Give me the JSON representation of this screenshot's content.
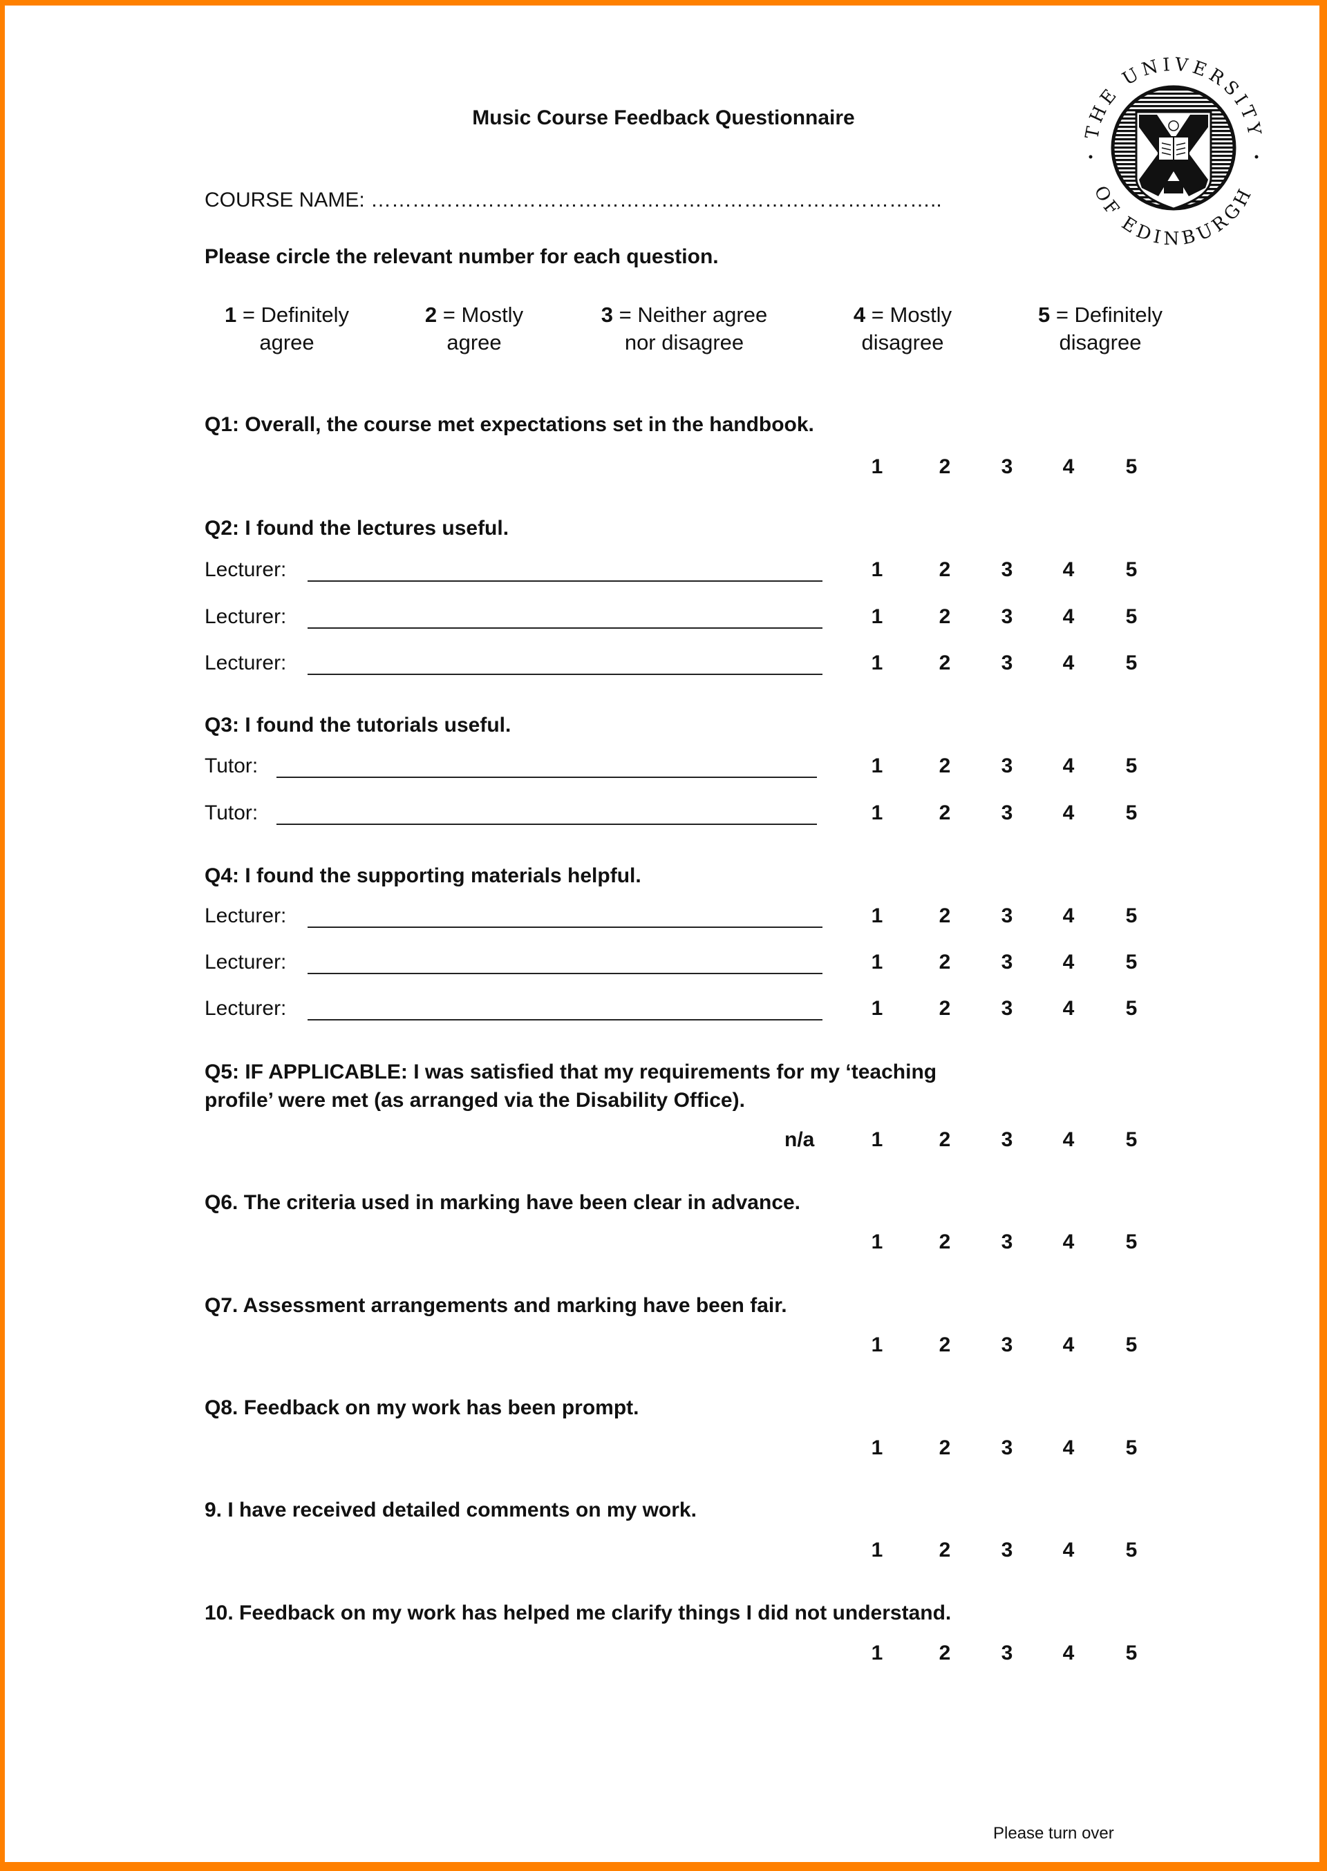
{
  "document": {
    "title": "Music Course Feedback Questionnaire",
    "course_name_label": "COURSE NAME: ………………………………………………………………………..",
    "instruction": "Please circle the relevant number for each question.",
    "logo": {
      "icon": "university-crest-icon",
      "ring_text_top": "THE UNIVERSITY",
      "ring_text_bottom": "OF EDINBURGH"
    },
    "border_color": "#ff8000",
    "footer": "Please turn over"
  },
  "scale": {
    "legend": [
      {
        "num": "1",
        "line1": " = Definitely",
        "line2": "agree"
      },
      {
        "num": "2",
        "line1": " = Mostly",
        "line2": "agree"
      },
      {
        "num": "3",
        "line1": " = Neither agree",
        "line2": "nor disagree"
      },
      {
        "num": "4",
        "line1": " = Mostly",
        "line2": "disagree"
      },
      {
        "num": "5",
        "line1": " = Definitely",
        "line2": "disagree"
      }
    ],
    "options": [
      "1",
      "2",
      "3",
      "4",
      "5"
    ],
    "na_label": "n/a"
  },
  "questions": [
    {
      "id": "q1",
      "text": "Q1: Overall, the course met expectations set in the handbook."
    },
    {
      "id": "q2",
      "text": "Q2: I found the lectures useful.",
      "rows": [
        {
          "label": "Lecturer:"
        },
        {
          "label": "Lecturer:"
        },
        {
          "label": "Lecturer:"
        }
      ]
    },
    {
      "id": "q3",
      "text": "Q3: I found the tutorials useful.",
      "rows": [
        {
          "label": "Tutor:"
        },
        {
          "label": "Tutor:"
        }
      ]
    },
    {
      "id": "q4",
      "text": "Q4: I found the supporting materials helpful.",
      "rows": [
        {
          "label": "Lecturer:"
        },
        {
          "label": "Lecturer:"
        },
        {
          "label": "Lecturer:"
        }
      ]
    },
    {
      "id": "q5",
      "text_line1": "Q5: IF APPLICABLE: I was satisfied that my requirements for my ‘teaching",
      "text_line2": "profile’ were met (as arranged via the Disability Office)."
    },
    {
      "id": "q6",
      "text": "Q6.  The criteria used in marking have been clear in advance."
    },
    {
      "id": "q7",
      "text": "Q7. Assessment arrangements and marking have been fair."
    },
    {
      "id": "q8",
      "text": "Q8. Feedback on my work has been prompt."
    },
    {
      "id": "q9",
      "text": "9. I have received detailed comments on my work."
    },
    {
      "id": "q10",
      "text": "10. Feedback on my work has helped me clarify things I did not understand."
    }
  ]
}
